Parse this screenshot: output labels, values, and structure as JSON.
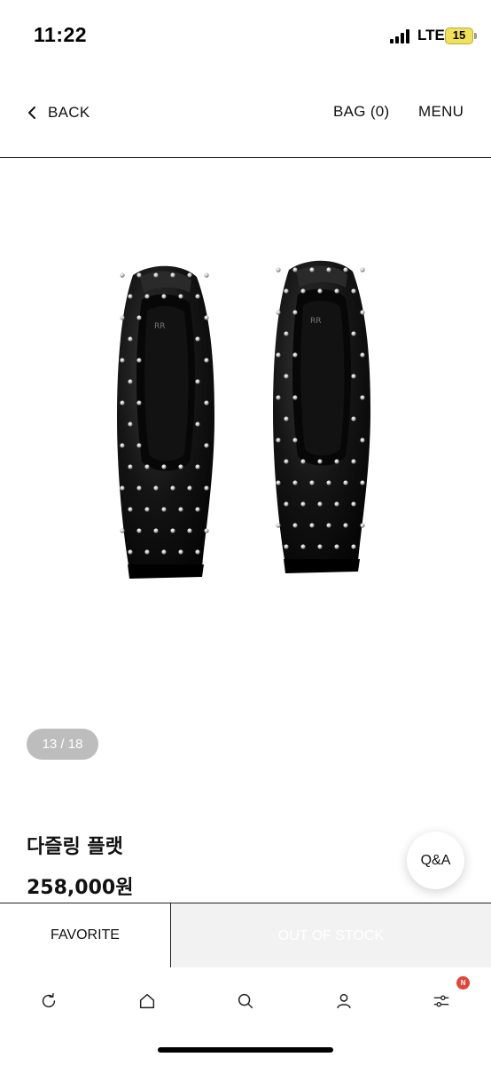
{
  "status_bar": {
    "time": "11:22",
    "network": "LTE",
    "battery": "15"
  },
  "header": {
    "back_label": "BACK",
    "bag_label": "BAG (0)",
    "menu_label": "MENU"
  },
  "gallery": {
    "counter": "13 / 18",
    "image_icon": "studded-ballet-flats-image"
  },
  "product": {
    "name": "다즐링 플랫",
    "price": "258,000원"
  },
  "qa_button": {
    "label": "Q&A"
  },
  "actions": {
    "favorite_label": "FAVORITE",
    "out_of_stock_label": "OUT OF STOCK"
  },
  "bottom_nav": {
    "items": [
      {
        "icon": "refresh-icon"
      },
      {
        "icon": "home-icon"
      },
      {
        "icon": "search-icon"
      },
      {
        "icon": "user-icon"
      },
      {
        "icon": "filter-icon"
      }
    ],
    "badge": "N"
  },
  "colors": {
    "badge": "#e0463b",
    "pill": "#bdbdbd",
    "disabled_bg": "#f2f2f2"
  }
}
